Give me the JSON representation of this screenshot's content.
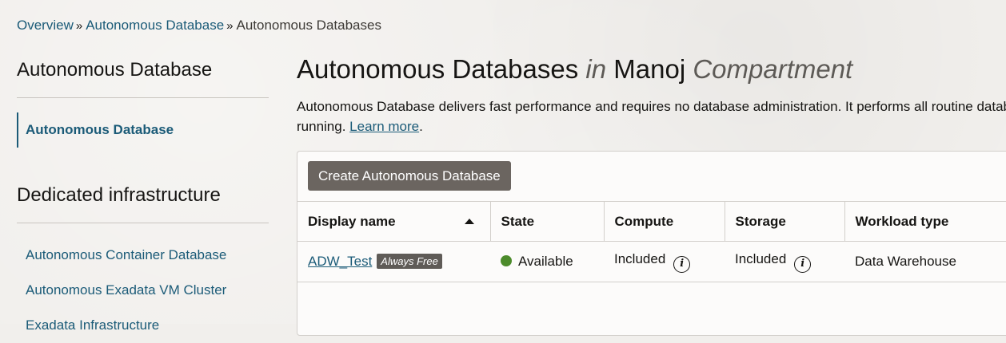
{
  "breadcrumb": {
    "items": [
      {
        "label": "Overview"
      },
      {
        "label": "Autonomous Database"
      }
    ],
    "separator": "»",
    "current": "Autonomous Databases"
  },
  "sidebar": {
    "heading": "Autonomous Database",
    "active_item": "Autonomous Database",
    "section2_heading": "Dedicated infrastructure",
    "items": [
      {
        "label": "Autonomous Container Database"
      },
      {
        "label": "Autonomous Exadata VM Cluster"
      },
      {
        "label": "Exadata Infrastructure"
      }
    ]
  },
  "main": {
    "title_prefix": "Autonomous Databases",
    "title_in": "in",
    "title_compartment": "Manoj",
    "title_suffix": "Compartment",
    "description_line1": "Autonomous Database delivers fast performance and requires no database administration. It performs all routine database",
    "description_line2_pre": "running.",
    "learn_more": "Learn more",
    "description_line2_post": "."
  },
  "toolbar": {
    "create_label": "Create Autonomous Database"
  },
  "table": {
    "columns": [
      "Display name",
      "State",
      "Compute",
      "Storage",
      "Workload type"
    ],
    "rows": [
      {
        "display_name": "ADW_Test",
        "badge": "Always Free",
        "state": "Available",
        "compute": "Included",
        "storage": "Included",
        "workload_type": "Data Warehouse"
      }
    ],
    "info_icon_glyph": "i"
  },
  "icons": {
    "sort": "sort-ascending-icon",
    "info": "info-icon",
    "status": "status-dot-icon"
  },
  "colors": {
    "link": "#1b5b78",
    "status_available": "#4c8b2b",
    "button_bg": "#6b6560",
    "badge_bg": "#5f5b57"
  }
}
